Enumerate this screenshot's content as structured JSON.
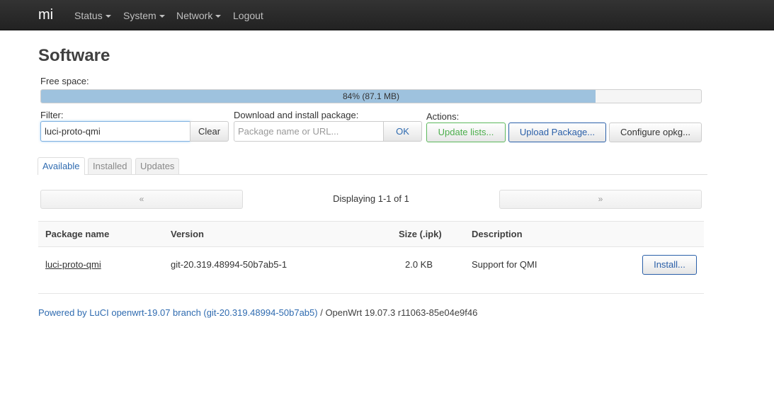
{
  "navbar": {
    "brand": "mi",
    "items": [
      {
        "label": "Status",
        "dropdown": true
      },
      {
        "label": "System",
        "dropdown": true
      },
      {
        "label": "Network",
        "dropdown": true
      },
      {
        "label": "Logout",
        "dropdown": false
      }
    ]
  },
  "page": {
    "title": "Software"
  },
  "free_space": {
    "label": "Free space:",
    "percent": 84,
    "text": "84% (87.1 MB)"
  },
  "filter": {
    "label": "Filter:",
    "value": "luci-proto-qmi",
    "clear_label": "Clear"
  },
  "download": {
    "label": "Download and install package:",
    "placeholder": "Package name or URL...",
    "ok_label": "OK"
  },
  "actions": {
    "label": "Actions:",
    "update_label": "Update lists...",
    "upload_label": "Upload Package...",
    "configure_label": "Configure opkg..."
  },
  "tabs": [
    {
      "label": "Available",
      "active": true
    },
    {
      "label": "Installed",
      "active": false
    },
    {
      "label": "Updates",
      "active": false
    }
  ],
  "pager": {
    "prev": "«",
    "next": "»",
    "status": "Displaying 1-1 of 1"
  },
  "table": {
    "headers": [
      "Package name",
      "Version",
      "Size (.ipk)",
      "Description"
    ],
    "rows": [
      {
        "name": "luci-proto-qmi",
        "version": "git-20.319.48994-50b7ab5-1",
        "size": "2.0 KB",
        "description": "Support for QMI",
        "action": "Install..."
      }
    ]
  },
  "footer": {
    "link_text": "Powered by LuCI openwrt-19.07 branch (git-20.319.48994-50b7ab5)",
    "suffix": " / OpenWrt 19.07.3 r11063-85e04e9f46"
  },
  "colors": {
    "navbar_bg": "#222222",
    "progress_fill": "#9ec2de",
    "link_blue": "#2f6bb0",
    "update_green": "#4cae4c",
    "upload_blue": "#2a5fa8"
  }
}
